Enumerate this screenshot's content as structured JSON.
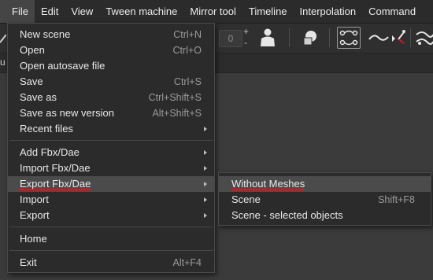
{
  "menubar": {
    "items": [
      "File",
      "Edit",
      "View",
      "Tween machine",
      "Mirror tool",
      "Timeline",
      "Interpolation",
      "Command"
    ]
  },
  "toolbar": {
    "frame_value": "0",
    "plus_label": "+",
    "minus_label": "-",
    "icons": [
      "move-icon",
      "person-icon",
      "shape-icon",
      "link-curve-icon",
      "curve-icon",
      "pick-icon",
      "curve-tool-icon"
    ]
  },
  "subbar": {
    "left_fragment": "u"
  },
  "file_menu": {
    "items": [
      {
        "label": "New scene",
        "shortcut": "Ctrl+N"
      },
      {
        "label": "Open",
        "shortcut": "Ctrl+O"
      },
      {
        "label": "Open autosave file",
        "shortcut": ""
      },
      {
        "label": "Save",
        "shortcut": "Ctrl+S"
      },
      {
        "label": "Save as",
        "shortcut": "Ctrl+Shift+S"
      },
      {
        "label": "Save as new version",
        "shortcut": "Alt+Shift+S"
      },
      {
        "label": "Recent files",
        "shortcut": ""
      },
      {
        "label": "Add Fbx/Dae",
        "shortcut": ""
      },
      {
        "label": "Import Fbx/Dae",
        "shortcut": ""
      },
      {
        "label": "Export Fbx/Dae",
        "shortcut": ""
      },
      {
        "label": "Import",
        "shortcut": ""
      },
      {
        "label": "Export",
        "shortcut": ""
      },
      {
        "label": "Home",
        "shortcut": ""
      },
      {
        "label": "Exit",
        "shortcut": "Alt+F4"
      }
    ]
  },
  "export_submenu": {
    "items": [
      {
        "label": "Without Meshes",
        "shortcut": ""
      },
      {
        "label": "Scene",
        "shortcut": "Shift+F8"
      },
      {
        "label": "Scene - selected objects",
        "shortcut": ""
      }
    ]
  },
  "colors": {
    "menu_bg": "#2b2b2b",
    "highlight": "#4b4b4b",
    "annotation_red": "#d6141e"
  }
}
